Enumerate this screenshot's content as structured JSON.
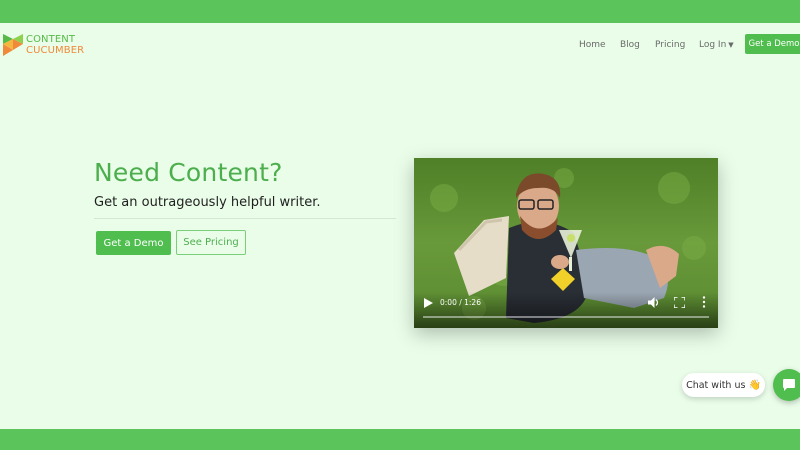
{
  "brand": {
    "logo_line1": "CONTENT",
    "logo_line2": "CUCUMBER",
    "colors": {
      "green": "#57b948",
      "orange": "#f08a3a",
      "accent": "#4fbe4f",
      "background": "#e9fde9"
    }
  },
  "nav": {
    "home": "Home",
    "blog": "Blog",
    "pricing": "Pricing",
    "login": "Log In",
    "demo_button": "Get a Demo"
  },
  "hero": {
    "title": "Need Content?",
    "subtitle": "Get an outrageously helpful writer.",
    "demo_button": "Get a Demo",
    "pricing_button": "See Pricing"
  },
  "video": {
    "time_display": "0:00 / 1:26",
    "progress": 0,
    "icons": [
      "play-icon",
      "volume-icon",
      "fullscreen-icon",
      "more-options-icon"
    ]
  },
  "chat": {
    "label": "Chat with us",
    "emoji": "👋",
    "launcher_icon": "chat-bubble-icon"
  }
}
